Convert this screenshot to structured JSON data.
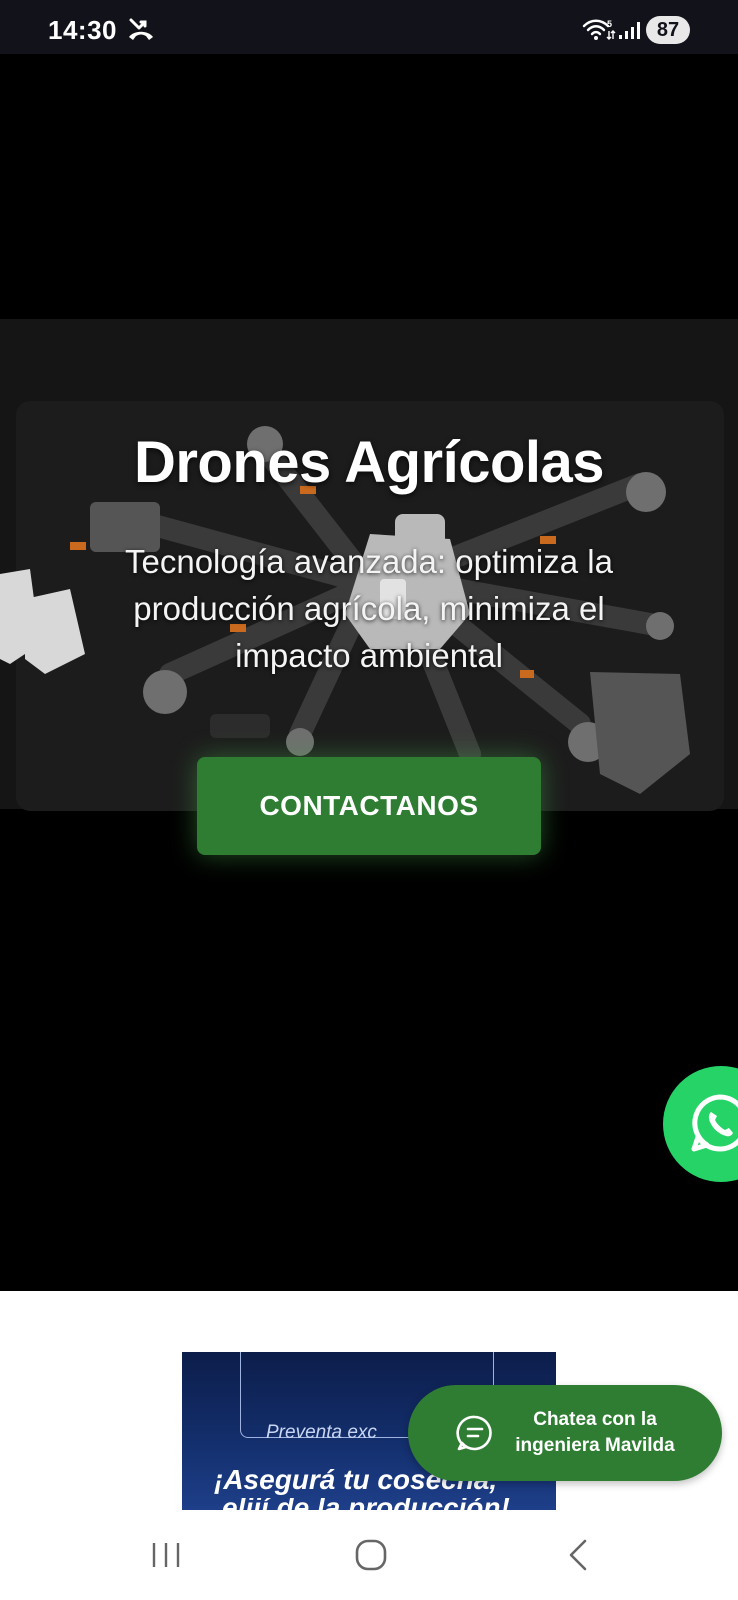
{
  "status_bar": {
    "time": "14:30",
    "battery": "87",
    "icons": [
      "missed-call-icon",
      "wifi-icon",
      "signal-icon"
    ]
  },
  "hero": {
    "title": "Drones Agrícolas",
    "subtitle": "Tecnología avanzada: optimiza la producción agrícola, minimiza el impacto ambiental",
    "cta_label": "CONTACTANOS"
  },
  "promo_banner": {
    "tag": "Preventa exc",
    "headline": "¡Asegurá tu cosecha,",
    "subline": "elijí de la producción!"
  },
  "chat_widget": {
    "label": "Chatea con la ingeniera Mavilda"
  },
  "floating": {
    "whatsapp_icon": "whatsapp-icon"
  },
  "nav_bar": {
    "icons": [
      "recents-icon",
      "home-icon",
      "back-icon"
    ]
  },
  "colors": {
    "accent_green": "#2e7d32",
    "whatsapp_green": "#25d366",
    "status_bar_bg": "#12131a",
    "banner_blue": "#14306f"
  }
}
